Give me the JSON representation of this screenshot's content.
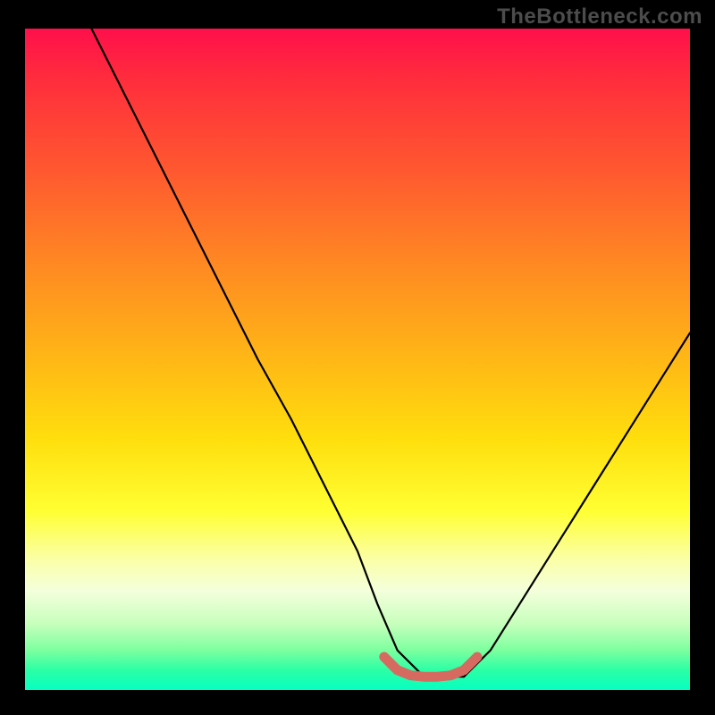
{
  "watermark": "TheBottleneck.com",
  "chart_data": {
    "type": "line",
    "title": "",
    "xlabel": "",
    "ylabel": "",
    "xlim": [
      0,
      100
    ],
    "ylim": [
      0,
      100
    ],
    "grid": false,
    "legend": false,
    "annotations": [],
    "series": [
      {
        "name": "bottleneck-curve",
        "color": "#000000",
        "x": [
          10,
          15,
          20,
          25,
          30,
          35,
          40,
          45,
          50,
          53,
          56,
          60,
          63,
          66,
          70,
          75,
          80,
          85,
          90,
          95,
          100
        ],
        "y": [
          100,
          90,
          80,
          70,
          60,
          50,
          41,
          31,
          21,
          13,
          6,
          2,
          2,
          2,
          6,
          14,
          22,
          30,
          38,
          46,
          54
        ]
      },
      {
        "name": "optimal-range-marker",
        "color": "#d76a60",
        "x": [
          54,
          56,
          58,
          60,
          62,
          64,
          66,
          68
        ],
        "y": [
          5,
          3,
          2.2,
          2,
          2,
          2.2,
          3,
          5
        ]
      }
    ],
    "gradient_stops": [
      {
        "pos": 0,
        "color": "#ff0f4b"
      },
      {
        "pos": 8,
        "color": "#ff2e3c"
      },
      {
        "pos": 22,
        "color": "#ff5a2f"
      },
      {
        "pos": 36,
        "color": "#ff8a22"
      },
      {
        "pos": 50,
        "color": "#ffb716"
      },
      {
        "pos": 62,
        "color": "#ffde0d"
      },
      {
        "pos": 73,
        "color": "#ffff33"
      },
      {
        "pos": 80,
        "color": "#fbffa3"
      },
      {
        "pos": 85,
        "color": "#f4ffdc"
      },
      {
        "pos": 90,
        "color": "#c7ffbc"
      },
      {
        "pos": 94,
        "color": "#7cff9f"
      },
      {
        "pos": 97,
        "color": "#2bffa5"
      },
      {
        "pos": 100,
        "color": "#06ffc1"
      }
    ]
  }
}
